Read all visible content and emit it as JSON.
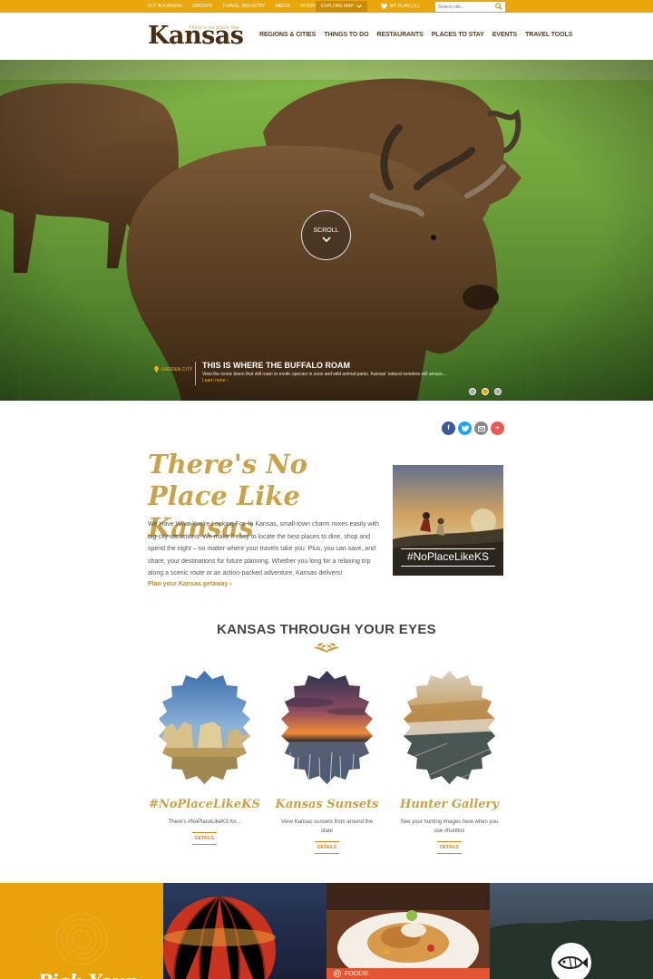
{
  "topbar": {
    "links": [
      "Fly in Kansas",
      "Groups",
      "Travel Industry",
      "Media",
      "International"
    ],
    "explore_label": "Explore Map",
    "myplan_label": "My Plan ( 0 )",
    "search_placeholder": "Search site..."
  },
  "header": {
    "logo_word": "Kansas",
    "logo_tag": "There's no place like",
    "nav": [
      "Regions & Cities",
      "Things to Do",
      "Restaurants",
      "Places to Stay",
      "Events",
      "Travel Tools"
    ]
  },
  "hero": {
    "scroll_label": "Scroll",
    "location": "Garden City",
    "title": "This is where the buffalo roam",
    "text": "View the iconic bison that still roam to exotic species in zoos and wild animal parks. Kansas' natural wonders will amaze...",
    "learn_more": "Learn more ›",
    "active_slide": 2,
    "slide_count": 3
  },
  "share": {
    "icons": [
      "facebook-icon",
      "twitter-icon",
      "email-icon",
      "plus-icon"
    ],
    "colors": [
      "#3b5998",
      "#1da1f2",
      "#888888",
      "#e85a4f"
    ]
  },
  "intro": {
    "title": "There's No Place Like Kansas",
    "body": "We Have What You're Looking For. In Kansas, small-town charm mixes easily with big-city attractions. We make it easy to locate the best places to dine, shop and spend the night – no matter where your travels take you. Plus, you can save, and share, your destinations for future planning. Whether you long for a relaxing trip along a scenic route or an action-packed adventure, Kansas delivers!",
    "link": "Plan your Kansas getaway ›",
    "promo_tag": "#NoPlaceLikeKS"
  },
  "eyes": {
    "title": "Kansas Through Your Eyes",
    "items": [
      {
        "title": "#NoPlaceLikeKS",
        "text": "There's #NoPlaceLikeKS for...",
        "details": "Details"
      },
      {
        "title": "Kansas Sunsets",
        "text": "View Kansas sunsets from around the state",
        "details": "Details"
      },
      {
        "title": "Hunter Gallery",
        "text": "See your hunting images here when you use #huntks!",
        "details": "Details"
      }
    ]
  },
  "tiles": {
    "tile1_label": "Pick Your",
    "foodie_label": "Foodie"
  },
  "colors": {
    "accent": "#e9a70c",
    "brand_brown": "#4a2e12",
    "gold_heading": "#c9a24a"
  }
}
